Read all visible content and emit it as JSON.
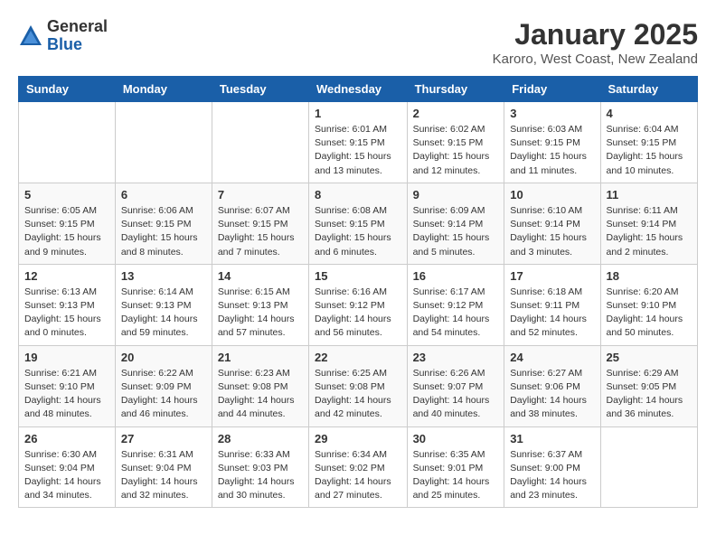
{
  "header": {
    "logo_general": "General",
    "logo_blue": "Blue",
    "title": "January 2025",
    "location": "Karoro, West Coast, New Zealand"
  },
  "weekdays": [
    "Sunday",
    "Monday",
    "Tuesday",
    "Wednesday",
    "Thursday",
    "Friday",
    "Saturday"
  ],
  "weeks": [
    [
      {
        "day": "",
        "info": ""
      },
      {
        "day": "",
        "info": ""
      },
      {
        "day": "",
        "info": ""
      },
      {
        "day": "1",
        "info": "Sunrise: 6:01 AM\nSunset: 9:15 PM\nDaylight: 15 hours\nand 13 minutes."
      },
      {
        "day": "2",
        "info": "Sunrise: 6:02 AM\nSunset: 9:15 PM\nDaylight: 15 hours\nand 12 minutes."
      },
      {
        "day": "3",
        "info": "Sunrise: 6:03 AM\nSunset: 9:15 PM\nDaylight: 15 hours\nand 11 minutes."
      },
      {
        "day": "4",
        "info": "Sunrise: 6:04 AM\nSunset: 9:15 PM\nDaylight: 15 hours\nand 10 minutes."
      }
    ],
    [
      {
        "day": "5",
        "info": "Sunrise: 6:05 AM\nSunset: 9:15 PM\nDaylight: 15 hours\nand 9 minutes."
      },
      {
        "day": "6",
        "info": "Sunrise: 6:06 AM\nSunset: 9:15 PM\nDaylight: 15 hours\nand 8 minutes."
      },
      {
        "day": "7",
        "info": "Sunrise: 6:07 AM\nSunset: 9:15 PM\nDaylight: 15 hours\nand 7 minutes."
      },
      {
        "day": "8",
        "info": "Sunrise: 6:08 AM\nSunset: 9:15 PM\nDaylight: 15 hours\nand 6 minutes."
      },
      {
        "day": "9",
        "info": "Sunrise: 6:09 AM\nSunset: 9:14 PM\nDaylight: 15 hours\nand 5 minutes."
      },
      {
        "day": "10",
        "info": "Sunrise: 6:10 AM\nSunset: 9:14 PM\nDaylight: 15 hours\nand 3 minutes."
      },
      {
        "day": "11",
        "info": "Sunrise: 6:11 AM\nSunset: 9:14 PM\nDaylight: 15 hours\nand 2 minutes."
      }
    ],
    [
      {
        "day": "12",
        "info": "Sunrise: 6:13 AM\nSunset: 9:13 PM\nDaylight: 15 hours\nand 0 minutes."
      },
      {
        "day": "13",
        "info": "Sunrise: 6:14 AM\nSunset: 9:13 PM\nDaylight: 14 hours\nand 59 minutes."
      },
      {
        "day": "14",
        "info": "Sunrise: 6:15 AM\nSunset: 9:13 PM\nDaylight: 14 hours\nand 57 minutes."
      },
      {
        "day": "15",
        "info": "Sunrise: 6:16 AM\nSunset: 9:12 PM\nDaylight: 14 hours\nand 56 minutes."
      },
      {
        "day": "16",
        "info": "Sunrise: 6:17 AM\nSunset: 9:12 PM\nDaylight: 14 hours\nand 54 minutes."
      },
      {
        "day": "17",
        "info": "Sunrise: 6:18 AM\nSunset: 9:11 PM\nDaylight: 14 hours\nand 52 minutes."
      },
      {
        "day": "18",
        "info": "Sunrise: 6:20 AM\nSunset: 9:10 PM\nDaylight: 14 hours\nand 50 minutes."
      }
    ],
    [
      {
        "day": "19",
        "info": "Sunrise: 6:21 AM\nSunset: 9:10 PM\nDaylight: 14 hours\nand 48 minutes."
      },
      {
        "day": "20",
        "info": "Sunrise: 6:22 AM\nSunset: 9:09 PM\nDaylight: 14 hours\nand 46 minutes."
      },
      {
        "day": "21",
        "info": "Sunrise: 6:23 AM\nSunset: 9:08 PM\nDaylight: 14 hours\nand 44 minutes."
      },
      {
        "day": "22",
        "info": "Sunrise: 6:25 AM\nSunset: 9:08 PM\nDaylight: 14 hours\nand 42 minutes."
      },
      {
        "day": "23",
        "info": "Sunrise: 6:26 AM\nSunset: 9:07 PM\nDaylight: 14 hours\nand 40 minutes."
      },
      {
        "day": "24",
        "info": "Sunrise: 6:27 AM\nSunset: 9:06 PM\nDaylight: 14 hours\nand 38 minutes."
      },
      {
        "day": "25",
        "info": "Sunrise: 6:29 AM\nSunset: 9:05 PM\nDaylight: 14 hours\nand 36 minutes."
      }
    ],
    [
      {
        "day": "26",
        "info": "Sunrise: 6:30 AM\nSunset: 9:04 PM\nDaylight: 14 hours\nand 34 minutes."
      },
      {
        "day": "27",
        "info": "Sunrise: 6:31 AM\nSunset: 9:04 PM\nDaylight: 14 hours\nand 32 minutes."
      },
      {
        "day": "28",
        "info": "Sunrise: 6:33 AM\nSunset: 9:03 PM\nDaylight: 14 hours\nand 30 minutes."
      },
      {
        "day": "29",
        "info": "Sunrise: 6:34 AM\nSunset: 9:02 PM\nDaylight: 14 hours\nand 27 minutes."
      },
      {
        "day": "30",
        "info": "Sunrise: 6:35 AM\nSunset: 9:01 PM\nDaylight: 14 hours\nand 25 minutes."
      },
      {
        "day": "31",
        "info": "Sunrise: 6:37 AM\nSunset: 9:00 PM\nDaylight: 14 hours\nand 23 minutes."
      },
      {
        "day": "",
        "info": ""
      }
    ]
  ]
}
